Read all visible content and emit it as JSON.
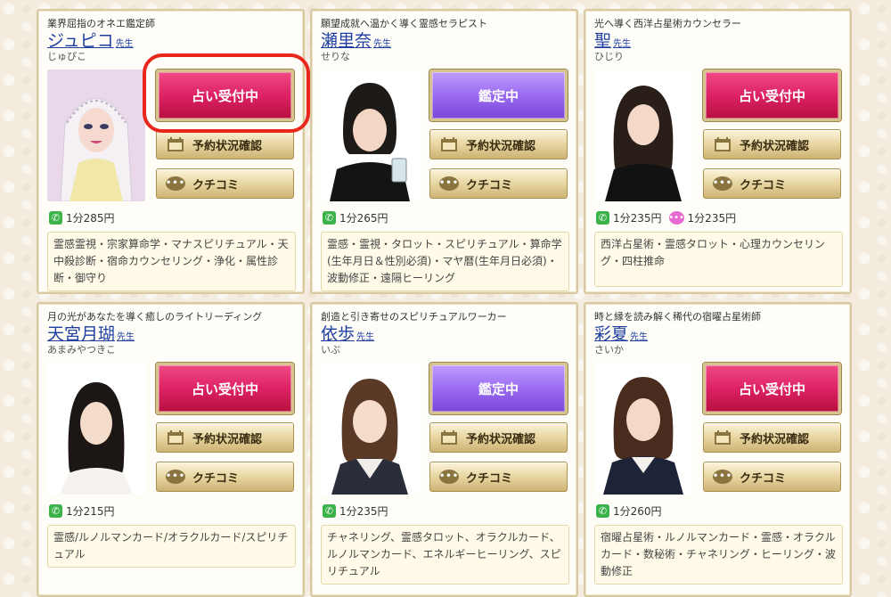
{
  "common": {
    "sensei_suffix": "先生",
    "reserve_label": "予約状況確認",
    "review_label": "クチコミ",
    "status_open": "占い受付中",
    "status_busy": "鑑定中"
  },
  "colors": {
    "status_open": "#dd2265",
    "status_busy": "#9a6bf0",
    "name_link": "#1e3fa0",
    "highlight": "#e8261c",
    "phone_icon": "#3bb24a",
    "chat_icon": "#e66ad2"
  },
  "cards": [
    {
      "subtitle": "業界屈指のオネエ鑑定師",
      "name": "ジュピコ",
      "reading": "じゅぴこ",
      "status": "open",
      "phone_price": "1分285円",
      "chat_price": "",
      "tags": "霊感霊視・宗家算命学・マナスピリチュアル・天中殺診断・宿命カウンセリング・浄化・属性診断・御守り"
    },
    {
      "subtitle": "願望成就へ温かく導く霊感セラピスト",
      "name": "瀬里奈",
      "reading": "せりな",
      "status": "busy",
      "phone_price": "1分265円",
      "chat_price": "",
      "tags": "霊感・霊視・タロット・スピリチュアル・算命学(生年月日＆性別必須)・マヤ暦(生年月日必須)・波動修正・遠隔ヒーリング"
    },
    {
      "subtitle": "光へ導く西洋占星術カウンセラー",
      "name": "聖",
      "reading": "ひじり",
      "status": "open",
      "phone_price": "1分235円",
      "chat_price": "1分235円",
      "tags": "西洋占星術・霊感タロット・心理カウンセリング・四柱推命"
    },
    {
      "subtitle": "月の光があなたを導く癒しのライトリーディング",
      "name": "天宮月瑚",
      "reading": "あまみやつきこ",
      "status": "open",
      "phone_price": "1分215円",
      "chat_price": "",
      "tags": "霊感/ルノルマンカード/オラクルカード/スピリチュアル"
    },
    {
      "subtitle": "創造と引き寄せのスピリチュアルワーカー",
      "name": "依歩",
      "reading": "いぶ",
      "status": "busy",
      "phone_price": "1分235円",
      "chat_price": "",
      "tags": "チャネリング、霊感タロット、オラクルカード、ルノルマンカード、エネルギーヒーリング、スピリチュアル"
    },
    {
      "subtitle": "時と縁を読み解く稀代の宿曜占星術師",
      "name": "彩夏",
      "reading": "さいか",
      "status": "open",
      "phone_price": "1分260円",
      "chat_price": "",
      "tags": "宿曜占星術・ルノルマンカード・霊感・オラクルカード・数秘術・チャネリング・ヒーリング・波動修正"
    }
  ]
}
